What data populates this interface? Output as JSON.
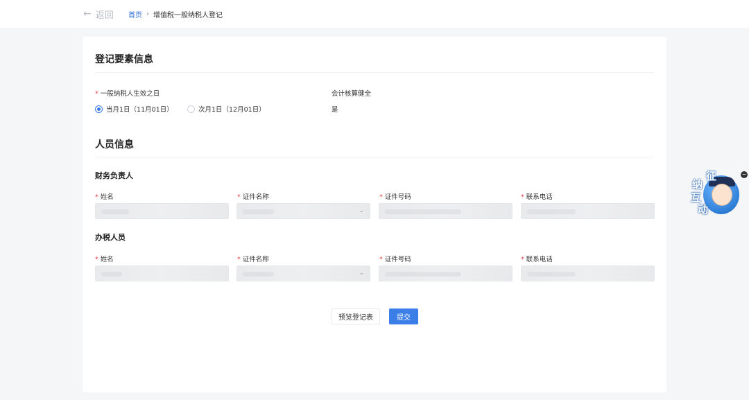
{
  "nav": {
    "back_label": "返回",
    "breadcrumb_home": "首页",
    "breadcrumb_sep": "›",
    "breadcrumb_current": "增值税一般纳税人登记"
  },
  "section1": {
    "title": "登记要素信息",
    "effective_date": {
      "required_mark": "*",
      "label": "一般纳税人生效之日",
      "options": [
        {
          "label": "当月1日（11月01日）",
          "checked": true
        },
        {
          "label": "次月1日（12月01日）",
          "checked": false
        }
      ]
    },
    "accounting": {
      "label": "会计核算健全",
      "value": "是"
    }
  },
  "section2": {
    "title": "人员信息",
    "finance_head": {
      "title": "财务负责人",
      "fields": [
        {
          "required_mark": "*",
          "label": "姓名"
        },
        {
          "required_mark": "*",
          "label": "证件名称"
        },
        {
          "required_mark": "*",
          "label": "证件号码"
        },
        {
          "required_mark": "*",
          "label": "联系电话"
        }
      ]
    },
    "tax_staff": {
      "title": "办税人员",
      "fields": [
        {
          "required_mark": "*",
          "label": "姓名"
        },
        {
          "required_mark": "*",
          "label": "证件名称"
        },
        {
          "required_mark": "*",
          "label": "证件号码"
        },
        {
          "required_mark": "*",
          "label": "联系电话"
        }
      ]
    }
  },
  "actions": {
    "preview_label": "预览登记表",
    "submit_label": "提交"
  },
  "mascot": {
    "chars": [
      "征",
      "纳",
      "互",
      "动"
    ],
    "close": "−"
  },
  "colors": {
    "accent": "#3b7ee8",
    "required": "#e54545",
    "link": "#2f6fd6"
  }
}
